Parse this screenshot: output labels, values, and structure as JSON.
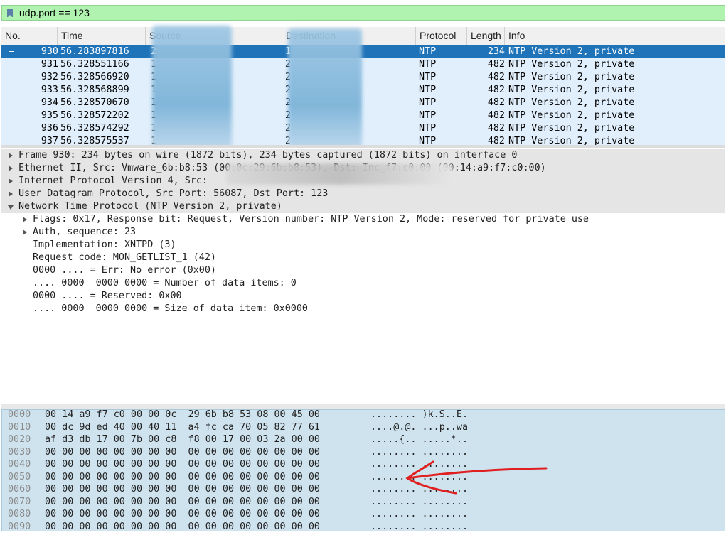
{
  "filter": {
    "value": "udp.port == 123"
  },
  "columns": [
    "No.",
    "Time",
    "Source",
    "Destination",
    "Protocol",
    "Length",
    "Info"
  ],
  "packets": [
    {
      "no": "930",
      "time": "56.283897816",
      "src": "2",
      "dst": "1",
      "proto": "NTP",
      "len": "234",
      "info": "NTP Version 2, private",
      "selected": true
    },
    {
      "no": "931",
      "time": "56.328551166",
      "src": "1",
      "dst": "2",
      "proto": "NTP",
      "len": "482",
      "info": "NTP Version 2, private"
    },
    {
      "no": "932",
      "time": "56.328566920",
      "src": "1",
      "dst": "2",
      "proto": "NTP",
      "len": "482",
      "info": "NTP Version 2, private"
    },
    {
      "no": "933",
      "time": "56.328568899",
      "src": "1",
      "dst": "2",
      "proto": "NTP",
      "len": "482",
      "info": "NTP Version 2, private"
    },
    {
      "no": "934",
      "time": "56.328570670",
      "src": "1",
      "dst": "2",
      "proto": "NTP",
      "len": "482",
      "info": "NTP Version 2, private"
    },
    {
      "no": "935",
      "time": "56.328572202",
      "src": "1",
      "dst": "2",
      "proto": "NTP",
      "len": "482",
      "info": "NTP Version 2, private"
    },
    {
      "no": "936",
      "time": "56.328574292",
      "src": "1",
      "dst": "2",
      "proto": "NTP",
      "len": "482",
      "info": "NTP Version 2, private"
    },
    {
      "no": "937",
      "time": "56.328575537",
      "src": "1",
      "dst": "2",
      "proto": "NTP",
      "len": "482",
      "info": "NTP Version 2, private"
    }
  ],
  "details": {
    "frame": "Frame 930: 234 bytes on wire (1872 bits), 234 bytes captured (1872 bits) on interface 0",
    "ethernet": "Ethernet II, Src: Vmware_6b:b8:53 (00:0c:29:6b:b8:53), Dst: Inc_f7:c0:00 (00:14:a9:f7:c0:00)",
    "ip": "Internet Protocol Version 4, Src:",
    "udp": "User Datagram Protocol, Src Port: 56087, Dst Port: 123",
    "ntp": "Network Time Protocol (NTP Version 2, private)",
    "ntp_children": [
      {
        "text": "Flags: 0x17, Response bit: Request, Version number: NTP Version 2, Mode: reserved for private use",
        "expandable": true
      },
      {
        "text": "Auth, sequence: 23",
        "expandable": true
      },
      {
        "text": "Implementation: XNTPD (3)",
        "expandable": false
      },
      {
        "text": "Request code: MON_GETLIST_1 (42)",
        "expandable": false
      },
      {
        "text": "0000 .... = Err: No error (0x00)",
        "expandable": false
      },
      {
        "text": ".... 0000  0000 0000 = Number of data items: 0",
        "expandable": false
      },
      {
        "text": "0000 .... = Reserved: 0x00",
        "expandable": false
      },
      {
        "text": ".... 0000  0000 0000 = Size of data item: 0x0000",
        "expandable": false
      }
    ]
  },
  "bytes": [
    {
      "ofs": "0000",
      "hex": "00 14 a9 f7 c0 00 00 0c  29 6b b8 53 08 00 45 00",
      "ascii": "........ )k.S..E."
    },
    {
      "ofs": "0010",
      "hex": "00 dc 9d ed 40 00 40 11  a4 fc ca 70 05 82 77 61",
      "ascii": "....@.@. ...p..wa"
    },
    {
      "ofs": "0020",
      "hex": "af d3 db 17 00 7b 00 c8  f8 00 17 00 03 2a 00 00",
      "ascii": ".....{.. .....*.."
    },
    {
      "ofs": "0030",
      "hex": "00 00 00 00 00 00 00 00  00 00 00 00 00 00 00 00",
      "ascii": "........ ........"
    },
    {
      "ofs": "0040",
      "hex": "00 00 00 00 00 00 00 00  00 00 00 00 00 00 00 00",
      "ascii": "........ ........"
    },
    {
      "ofs": "0050",
      "hex": "00 00 00 00 00 00 00 00  00 00 00 00 00 00 00 00",
      "ascii": "........ ........"
    },
    {
      "ofs": "0060",
      "hex": "00 00 00 00 00 00 00 00  00 00 00 00 00 00 00 00",
      "ascii": "........ ........"
    },
    {
      "ofs": "0070",
      "hex": "00 00 00 00 00 00 00 00  00 00 00 00 00 00 00 00",
      "ascii": "........ ........"
    },
    {
      "ofs": "0080",
      "hex": "00 00 00 00 00 00 00 00  00 00 00 00 00 00 00 00",
      "ascii": "........ ........"
    },
    {
      "ofs": "0090",
      "hex": "00 00 00 00 00 00 00 00  00 00 00 00 00 00 00 00",
      "ascii": "........ ........"
    }
  ],
  "colors": {
    "selected_row": "#1f73b8",
    "filter_bg": "#b0f2b0",
    "list_bg": "#e1effc",
    "bytes_bg": "#cfe3ef",
    "annotation": "#e02020"
  }
}
